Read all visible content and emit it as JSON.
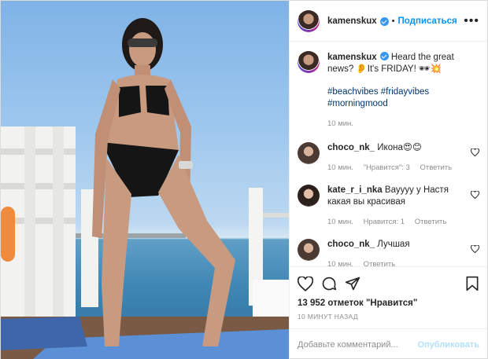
{
  "header": {
    "username": "kamenskux",
    "follow_label": "Подписаться",
    "separator": "•"
  },
  "caption": {
    "username": "kamenskux",
    "text": "Heard the great news? 👂It's FRIDAY! 🕶💥",
    "hashtags": [
      "#beachvibes",
      "#fridayvibes",
      "#morningmood"
    ],
    "time": "10 мин."
  },
  "comments": [
    {
      "username": "choco_nk_",
      "text": "Икона😍😊",
      "time": "10 мин.",
      "likes": "\"Нравится\": 3",
      "reply": "Ответить"
    },
    {
      "username": "kate_r_i_nka",
      "text": "Вауууу у Настя какая вы красивая",
      "time": "10 мин.",
      "likes": "Нравится: 1",
      "reply": "Ответить"
    },
    {
      "username": "choco_nk_",
      "text": "Лучшая",
      "time": "10 мин.",
      "likes": "",
      "reply": "Ответить"
    }
  ],
  "stats": {
    "likes": "13 952 отметок \"Нравится\"",
    "posted": "10 МИНУТ НАЗАД"
  },
  "add_comment": {
    "placeholder": "Добавьте комментарий...",
    "publish": "Опубликовать"
  },
  "icons": {
    "like": "heart-icon",
    "comment": "comment-icon",
    "share": "share-icon",
    "save": "bookmark-icon",
    "more": "more-icon"
  },
  "colors": {
    "accent": "#0095f6",
    "verified": "#3897f0",
    "muted": "#8e8e8e",
    "publish_disabled": "#b2dffc"
  }
}
